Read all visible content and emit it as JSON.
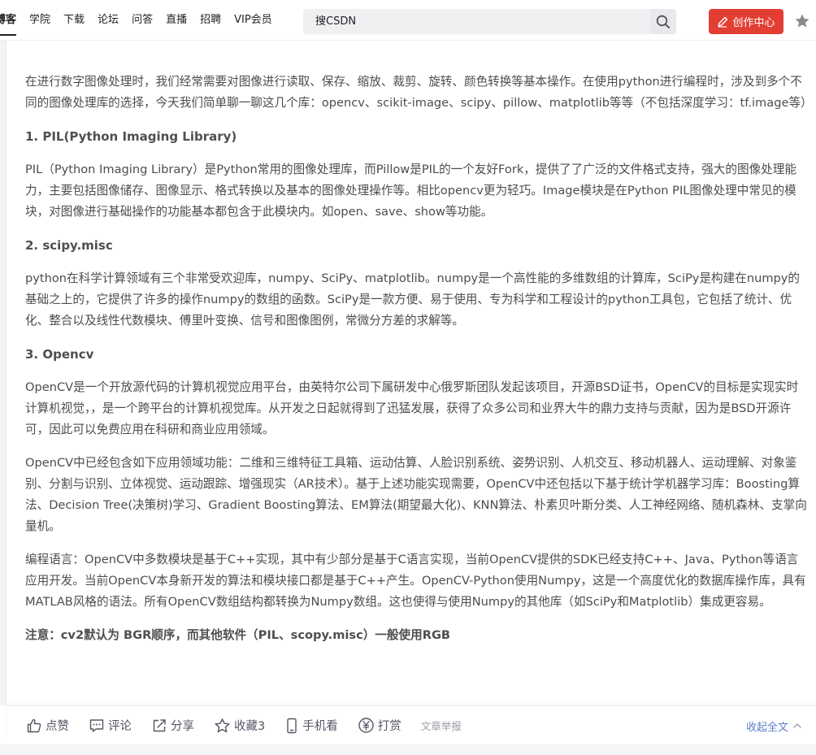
{
  "nav": {
    "items": [
      {
        "label": "博客",
        "active": true
      },
      {
        "label": "学院",
        "active": false
      },
      {
        "label": "下载",
        "active": false
      },
      {
        "label": "论坛",
        "active": false
      },
      {
        "label": "问答",
        "active": false
      },
      {
        "label": "直播",
        "active": false
      },
      {
        "label": "招聘",
        "active": false
      },
      {
        "label": "VIP会员",
        "active": false
      }
    ]
  },
  "search": {
    "placeholder": "搜CSDN",
    "value": ""
  },
  "header": {
    "create_label": "创作中心"
  },
  "colors": {
    "brand_red": "#e33e33",
    "link_blue": "#5d7ec9"
  },
  "article": {
    "intro": "在进行数字图像处理时，我们经常需要对图像进行读取、保存、缩放、裁剪、旋转、颜色转换等基本操作。在使用python进行编程时，涉及到多个不同的图像处理库的选择，今天我们简单聊一聊这几个库：opencv、scikit-image、scipy、pillow、matplotlib等等（不包括深度学习：tf.image等）",
    "sections": [
      {
        "heading": "1. PIL(Python Imaging Library)",
        "paragraphs": [
          "PIL（Python Imaging Library）是Python常用的图像处理库，而Pillow是PIL的一个友好Fork，提供了了广泛的文件格式支持，强大的图像处理能力，主要包括图像储存、图像显示、格式转换以及基本的图像处理操作等。相比opencv更为轻巧。Image模块是在Python PIL图像处理中常见的模块，对图像进行基础操作的功能基本都包含于此模块内。如open、save、show等功能。"
        ]
      },
      {
        "heading": "2. scipy.misc",
        "paragraphs": [
          "python在科学计算领域有三个非常受欢迎库，numpy、SciPy、matplotlib。numpy是一个高性能的多维数组的计算库，SciPy是构建在numpy的基础之上的，它提供了许多的操作numpy的数组的函数。SciPy是一款方便、易于使用、专为科学和工程设计的python工具包，它包括了统计、优化、整合以及线性代数模块、傅里叶变换、信号和图像图例，常微分方差的求解等。"
        ]
      },
      {
        "heading": "3. Opencv",
        "paragraphs": [
          "OpenCV是一个开放源代码的计算机视觉应用平台，由英特尔公司下属研发中心俄罗斯团队发起该项目，开源BSD证书，OpenCV的目标是实现实时计算机视觉，，是一个跨平台的计算机视觉库。从开发之日起就得到了迅猛发展，获得了众多公司和业界大牛的鼎力支持与贡献，因为是BSD开源许可，因此可以免费应用在科研和商业应用领域。",
          "OpenCV中已经包含如下应用领域功能：二维和三维特征工具箱、运动估算、人脸识别系统、姿势识别、人机交互、移动机器人、运动理解、对象鉴别、分割与识别、立体视觉、运动跟踪、增强现实（AR技术）。基于上述功能实现需要，OpenCV中还包括以下基于统计学机器学习库：Boosting算法、Decision Tree(决策树)学习、Gradient Boosting算法、EM算法(期望最大化)、KNN算法、朴素贝叶斯分类、人工神经网络、随机森林、支掌向量机。",
          "编程语言：OpenCV中多数模块是基于C++实现，其中有少部分是基于C语言实现，当前OpenCV提供的SDK已经支持C++、Java、Python等语言应用开发。当前OpenCV本身新开发的算法和模块接口都是基于C++产生。OpenCV-Python使用Numpy，这是一个高度优化的数据库操作库，具有MATLAB风格的语法。所有OpenCV数组结构都转换为Numpy数组。这也使得与使用Numpy的其他库（如SciPy和Matplotlib）集成更容易。"
        ]
      }
    ],
    "note": "注意：cv2默认为 BGR顺序，而其他软件（PIL、scopy.misc）一般使用RGB"
  },
  "toolbar": {
    "like_label": "点赞",
    "comment_label": "评论",
    "share_label": "分享",
    "collect_label": "收藏3",
    "mobile_label": "手机看",
    "reward_label": "打赏",
    "report_label": "文章举报",
    "collapse_label": "收起全文"
  }
}
